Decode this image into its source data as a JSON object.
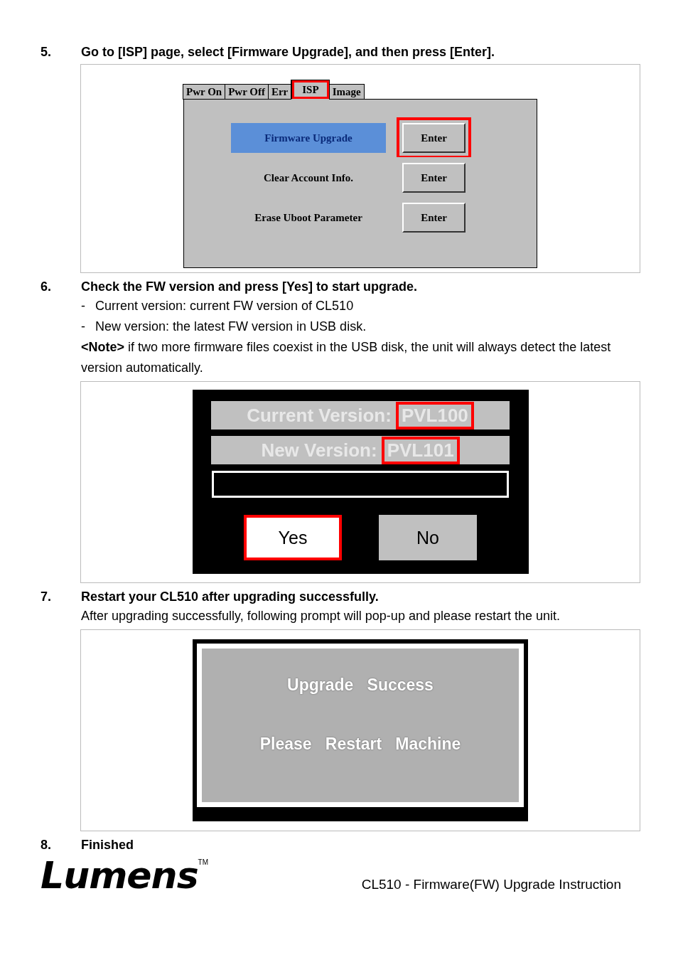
{
  "steps": [
    {
      "number": "5.",
      "title": "Go to [ISP] page, select [Firmware Upgrade], and then press [Enter].",
      "figure": {
        "kind": "isp_menu",
        "tabs": [
          {
            "label": "Pwr On",
            "selected": false,
            "highlighted": false
          },
          {
            "label": "Pwr Off",
            "selected": false,
            "highlighted": false
          },
          {
            "label": "Err",
            "selected": false,
            "highlighted": false
          },
          {
            "label": "ISP",
            "selected": true,
            "highlighted": true
          },
          {
            "label": "Image",
            "selected": false,
            "highlighted": false
          }
        ],
        "rows": [
          {
            "label": "Firmware Upgrade",
            "selected": true,
            "button": "Enter",
            "highlighted": true
          },
          {
            "label": "Clear Account Info.",
            "selected": false,
            "button": "Enter",
            "highlighted": false
          },
          {
            "label": "Erase Uboot Parameter",
            "selected": false,
            "button": "Enter",
            "highlighted": false
          }
        ]
      }
    },
    {
      "number": "6.",
      "title": "Check the FW version and press [Yes] to start upgrade.",
      "bullets": [
        {
          "marker": "-",
          "text": "Current version: current FW version of CL510"
        },
        {
          "marker": "-",
          "text": "New version: the latest FW version in USB disk."
        }
      ],
      "note": "**<Note>** if two more firmware files coexist in the USB disk, the unit will always detect the latest version automatically.",
      "figure": {
        "kind": "version_dialog",
        "fields": [
          {
            "label": "Current Version:",
            "value": "PVL100",
            "highlighted": true
          },
          {
            "label": "New Version:",
            "value": "PVL101",
            "highlighted": true
          }
        ],
        "buttons": [
          {
            "label": "Yes",
            "highlighted": true
          },
          {
            "label": "No",
            "highlighted": false
          }
        ]
      }
    },
    {
      "number": "7.",
      "title": "Restart your CL510 after upgrading successfully.",
      "text": "After upgrading successfully, following prompt will pop-up and please restart the unit.",
      "figure": {
        "kind": "message_box",
        "lines": [
          "Upgrade   Success",
          "Please   Restart   Machine"
        ]
      }
    },
    {
      "number": "8.",
      "title": "Finished"
    }
  ],
  "footer": {
    "logo": "Lumens",
    "trademark": "TM",
    "caption": "CL510 - Firmware(FW) Upgrade Instruction"
  }
}
